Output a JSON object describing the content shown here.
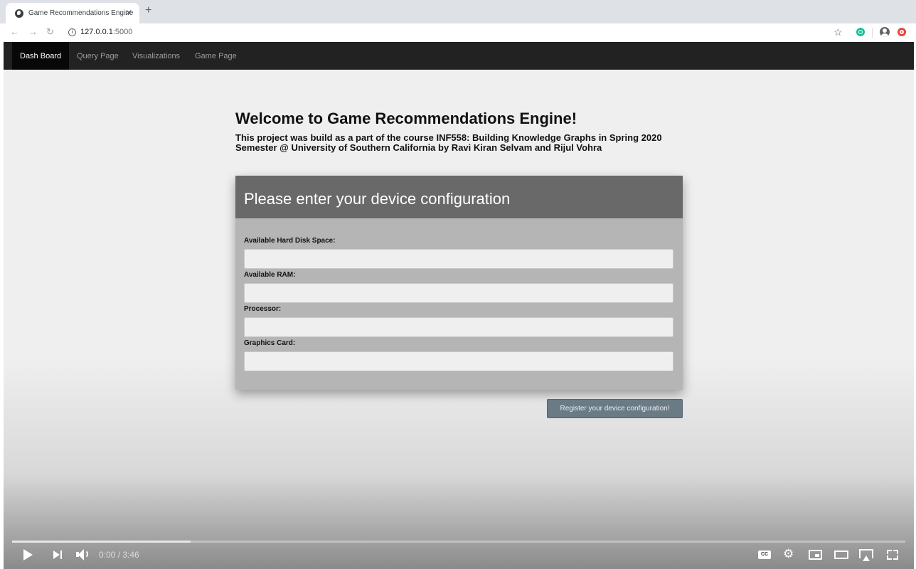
{
  "browser": {
    "tab_title": "Game Recommendations Engine",
    "tab_close": "✕",
    "new_tab": "+",
    "url_host": "127.0.0.1",
    "url_port": ":5000",
    "icons": [
      "globe-icon",
      "back-icon",
      "forward-icon",
      "reload-icon",
      "info-icon",
      "star-icon",
      "grammarly-icon",
      "profile-icon",
      "opera-icon"
    ]
  },
  "navbar": {
    "items": [
      {
        "label": "Dash Board",
        "active": true
      },
      {
        "label": "Query Page",
        "active": false
      },
      {
        "label": "Visualizations",
        "active": false
      },
      {
        "label": "Game Page",
        "active": false
      }
    ]
  },
  "main": {
    "heading": "Welcome to Game Recommendations Engine!",
    "subtext": "This project was build as a part of the course INF558: Building Knowledge Graphs in Spring 2020 Semester @ University of Southern California by Ravi Kiran Selvam and Rijul Vohra"
  },
  "form": {
    "title": "Please enter your device configuration",
    "fields": [
      {
        "label": "Available Hard Disk Space:",
        "value": ""
      },
      {
        "label": "Available RAM:",
        "value": ""
      },
      {
        "label": "Processor:",
        "value": ""
      },
      {
        "label": "Graphics Card:",
        "value": ""
      }
    ],
    "submit_label": "Register your device configuration!"
  },
  "player": {
    "time": "0:00 / 3:46",
    "buffered_fraction": 0.2,
    "cc_label": "CC"
  },
  "colors": {
    "navbar_bg": "#222222",
    "card_header": "#696969",
    "card_body": "#b5b5b5",
    "button_bg": "#6a7b86"
  }
}
